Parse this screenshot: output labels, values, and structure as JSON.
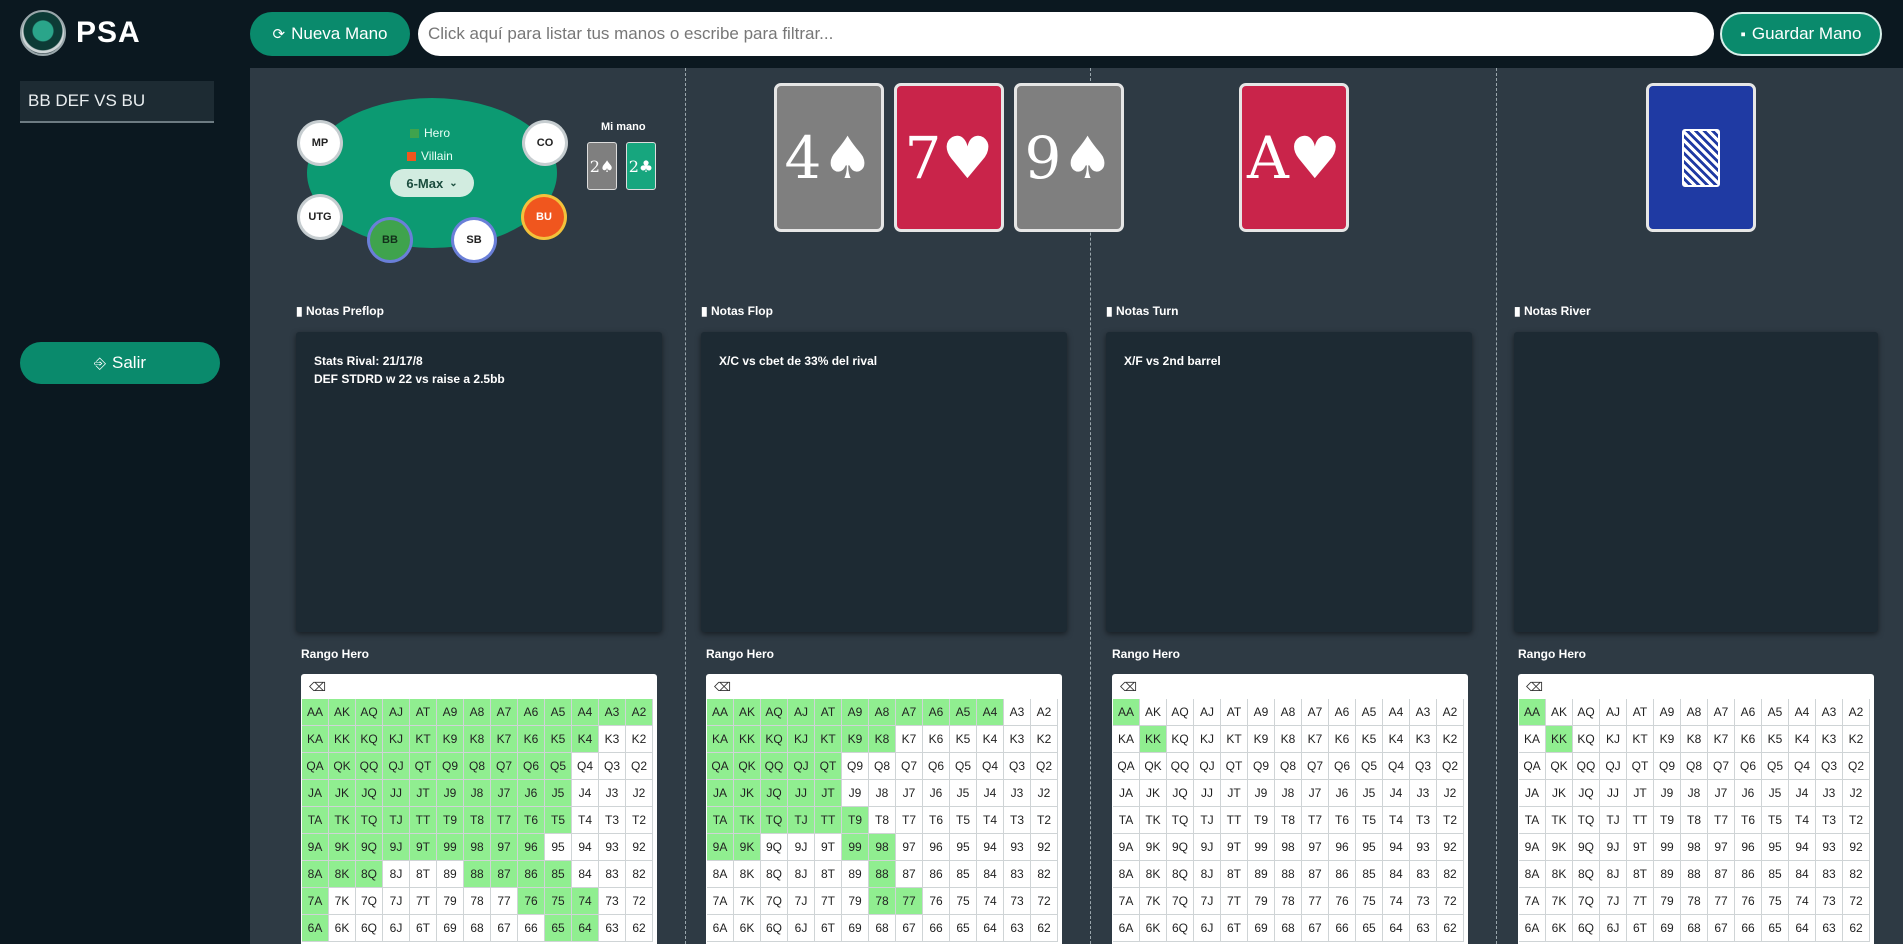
{
  "app": {
    "name": "PSA"
  },
  "toolbar": {
    "new_hand_label": "Nueva Mano",
    "new_hand_icon": "refresh-icon",
    "search_placeholder": "Click aquí para listar tus manos o escribe para filtrar...",
    "search_value": "",
    "save_label": "Guardar Mano",
    "save_icon": "floppy-disk-icon"
  },
  "sidebar": {
    "hands": [
      {
        "label": "BB DEF VS BU"
      }
    ],
    "exit_label": "Salir",
    "exit_icon": "door-exit-icon"
  },
  "table": {
    "legend_hero": "Hero",
    "legend_villain": "Villain",
    "hero_color": "#3fa34d",
    "villain_color": "#f0561e",
    "format": "6-Max",
    "seats": [
      "MP",
      "CO",
      "UTG",
      "BB",
      "SB",
      "BU"
    ],
    "hero_seat": "BB",
    "villain_seat": "BU",
    "my_hand_label": "Mi mano",
    "my_hand": [
      "2♠",
      "2♣"
    ]
  },
  "board": {
    "flop": [
      "4♠",
      "7♥",
      "9♠"
    ],
    "turn": "A♥",
    "river": "face-down"
  },
  "notes": {
    "preflop": {
      "label": "Notas Preflop",
      "lines": [
        "Stats Rival: 21/17/8",
        "DEF STDRD w 22 vs raise a 2.5bb"
      ]
    },
    "flop": {
      "label": "Notas Flop",
      "lines": [
        "X/C vs cbet de 33% del rival"
      ]
    },
    "turn": {
      "label": "Notas Turn",
      "lines": [
        "X/F vs 2nd barrel"
      ]
    },
    "river": {
      "label": "Notas River",
      "lines": []
    }
  },
  "ranges": {
    "label": "Rango Hero",
    "eraser_icon": "eraser-icon",
    "highlight_color": "#90ee90",
    "grid": [
      [
        "AA",
        "AK",
        "AQ",
        "AJ",
        "AT",
        "A9",
        "A8",
        "A7",
        "A6",
        "A5",
        "A4",
        "A3",
        "A2"
      ],
      [
        "KA",
        "KK",
        "KQ",
        "KJ",
        "KT",
        "K9",
        "K8",
        "K7",
        "K6",
        "K5",
        "K4",
        "K3",
        "K2"
      ],
      [
        "QA",
        "QK",
        "QQ",
        "QJ",
        "QT",
        "Q9",
        "Q8",
        "Q7",
        "Q6",
        "Q5",
        "Q4",
        "Q3",
        "Q2"
      ],
      [
        "JA",
        "JK",
        "JQ",
        "JJ",
        "JT",
        "J9",
        "J8",
        "J7",
        "J6",
        "J5",
        "J4",
        "J3",
        "J2"
      ],
      [
        "TA",
        "TK",
        "TQ",
        "TJ",
        "TT",
        "T9",
        "T8",
        "T7",
        "T6",
        "T5",
        "T4",
        "T3",
        "T2"
      ],
      [
        "9A",
        "9K",
        "9Q",
        "9J",
        "9T",
        "99",
        "98",
        "97",
        "96",
        "95",
        "94",
        "93",
        "92"
      ],
      [
        "8A",
        "8K",
        "8Q",
        "8J",
        "8T",
        "89",
        "88",
        "87",
        "86",
        "85",
        "84",
        "83",
        "82"
      ],
      [
        "7A",
        "7K",
        "7Q",
        "7J",
        "7T",
        "79",
        "78",
        "77",
        "76",
        "75",
        "74",
        "73",
        "72"
      ],
      [
        "6A",
        "6K",
        "6Q",
        "6J",
        "6T",
        "69",
        "68",
        "67",
        "66",
        "65",
        "64",
        "63",
        "62"
      ]
    ],
    "preflop_selected": [
      "AA",
      "AK",
      "AQ",
      "AJ",
      "AT",
      "A9",
      "A8",
      "A7",
      "A6",
      "A5",
      "A4",
      "A3",
      "A2",
      "KA",
      "KK",
      "KQ",
      "KJ",
      "KT",
      "K9",
      "K8",
      "K7",
      "K6",
      "K5",
      "K4",
      "QA",
      "QK",
      "QQ",
      "QJ",
      "QT",
      "Q9",
      "Q8",
      "Q7",
      "Q6",
      "Q5",
      "JA",
      "JK",
      "JQ",
      "JJ",
      "JT",
      "J9",
      "J8",
      "J7",
      "J6",
      "J5",
      "TA",
      "TK",
      "TQ",
      "TJ",
      "TT",
      "T9",
      "T8",
      "T7",
      "T6",
      "T5",
      "9A",
      "9K",
      "9Q",
      "9J",
      "9T",
      "99",
      "98",
      "97",
      "96",
      "8A",
      "8K",
      "8Q",
      "88",
      "87",
      "86",
      "85",
      "7A",
      "76",
      "75",
      "74",
      "6A",
      "65",
      "64"
    ],
    "flop_selected": [
      "AA",
      "AK",
      "AQ",
      "AJ",
      "AT",
      "A9",
      "A8",
      "A7",
      "A6",
      "A5",
      "A4",
      "KA",
      "KK",
      "KQ",
      "KJ",
      "KT",
      "K9",
      "K8",
      "QA",
      "QK",
      "QQ",
      "QJ",
      "QT",
      "JA",
      "JK",
      "JQ",
      "JJ",
      "JT",
      "TA",
      "TK",
      "TQ",
      "TJ",
      "TT",
      "T9",
      "9A",
      "9K",
      "99",
      "98",
      "88",
      "78",
      "77"
    ],
    "turn_selected": [
      "AA",
      "KK"
    ],
    "river_selected": [
      "AA",
      "KK"
    ]
  }
}
